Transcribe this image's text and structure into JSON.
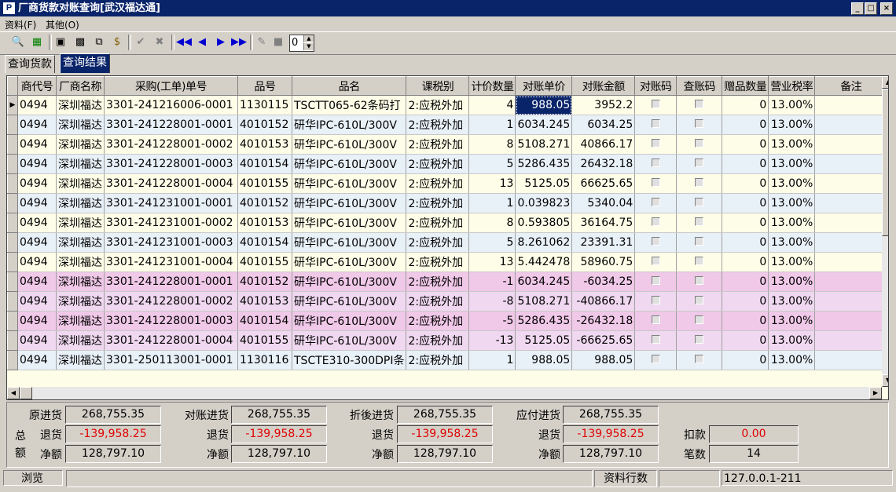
{
  "window": {
    "icon": "P",
    "title": "厂商货款对账查询[武汉福达通]",
    "min": "_",
    "max": "□",
    "close": "×"
  },
  "menu": [
    "资料(F)",
    "其他(O)"
  ],
  "toolbar": {
    "spin_value": "0"
  },
  "tabs": [
    "查询货款",
    "查询结果"
  ],
  "columns": [
    "商代号",
    "厂商名称",
    "采购(工单)单号",
    "品号",
    "品名",
    "课税别",
    "计价数量",
    "对账单价",
    "对账金额",
    "对账码",
    "查账码",
    "赠品数量",
    "营业税率",
    "备注"
  ],
  "rows": [
    [
      "0494",
      "深圳福达",
      "3301-241216006-0001",
      "1130115",
      "TSCTT065-62条码打",
      "2:应税外加",
      "4",
      "988.05",
      "3952.2",
      "",
      "",
      "0",
      "13.00%",
      ""
    ],
    [
      "0494",
      "深圳福达",
      "3301-241228001-0001",
      "4010152",
      "研华IPC-610L/300V",
      "2:应税外加",
      "1",
      "6034.245",
      "6034.25",
      "",
      "",
      "0",
      "13.00%",
      ""
    ],
    [
      "0494",
      "深圳福达",
      "3301-241228001-0002",
      "4010153",
      "研华IPC-610L/300V",
      "2:应税外加",
      "8",
      "5108.271",
      "40866.17",
      "",
      "",
      "0",
      "13.00%",
      ""
    ],
    [
      "0494",
      "深圳福达",
      "3301-241228001-0003",
      "4010154",
      "研华IPC-610L/300V",
      "2:应税外加",
      "5",
      "5286.435",
      "26432.18",
      "",
      "",
      "0",
      "13.00%",
      ""
    ],
    [
      "0494",
      "深圳福达",
      "3301-241228001-0004",
      "4010155",
      "研华IPC-610L/300V",
      "2:应税外加",
      "13",
      "5125.05",
      "66625.65",
      "",
      "",
      "0",
      "13.00%",
      ""
    ],
    [
      "0494",
      "深圳福达",
      "3301-241231001-0001",
      "4010152",
      "研华IPC-610L/300V",
      "2:应税外加",
      "1",
      "0.039823",
      "5340.04",
      "",
      "",
      "0",
      "13.00%",
      ""
    ],
    [
      "0494",
      "深圳福达",
      "3301-241231001-0002",
      "4010153",
      "研华IPC-610L/300V",
      "2:应税外加",
      "8",
      "0.593805",
      "36164.75",
      "",
      "",
      "0",
      "13.00%",
      ""
    ],
    [
      "0494",
      "深圳福达",
      "3301-241231001-0003",
      "4010154",
      "研华IPC-610L/300V",
      "2:应税外加",
      "5",
      "8.261062",
      "23391.31",
      "",
      "",
      "0",
      "13.00%",
      ""
    ],
    [
      "0494",
      "深圳福达",
      "3301-241231001-0004",
      "4010155",
      "研华IPC-610L/300V",
      "2:应税外加",
      "13",
      "5.442478",
      "58960.75",
      "",
      "",
      "0",
      "13.00%",
      ""
    ],
    [
      "0494",
      "深圳福达",
      "3301-241228001-0001",
      "4010152",
      "研华IPC-610L/300V",
      "2:应税外加",
      "-1",
      "6034.245",
      "-6034.25",
      "",
      "",
      "0",
      "13.00%",
      ""
    ],
    [
      "0494",
      "深圳福达",
      "3301-241228001-0002",
      "4010153",
      "研华IPC-610L/300V",
      "2:应税外加",
      "-8",
      "5108.271",
      "-40866.17",
      "",
      "",
      "0",
      "13.00%",
      ""
    ],
    [
      "0494",
      "深圳福达",
      "3301-241228001-0003",
      "4010154",
      "研华IPC-610L/300V",
      "2:应税外加",
      "-5",
      "5286.435",
      "-26432.18",
      "",
      "",
      "0",
      "13.00%",
      ""
    ],
    [
      "0494",
      "深圳福达",
      "3301-241228001-0004",
      "4010155",
      "研华IPC-610L/300V",
      "2:应税外加",
      "-13",
      "5125.05",
      "-66625.65",
      "",
      "",
      "0",
      "13.00%",
      ""
    ],
    [
      "0494",
      "深圳福达",
      "3301-250113001-0001",
      "1130116",
      "TSCTE310-300DPI条",
      "2:应税外加",
      "1",
      "988.05",
      "988.05",
      "",
      "",
      "0",
      "13.00%",
      ""
    ]
  ],
  "totals": {
    "side_label": [
      "总",
      "额"
    ],
    "groups": [
      {
        "labels": [
          "原进货",
          "退货",
          "净额"
        ],
        "values": [
          "268,755.35",
          "-139,958.25",
          "128,797.10"
        ]
      },
      {
        "labels": [
          "对账进货",
          "退货",
          "净额"
        ],
        "values": [
          "268,755.35",
          "-139,958.25",
          "128,797.10"
        ]
      },
      {
        "labels": [
          "折後进货",
          "退货",
          "净额"
        ],
        "values": [
          "268,755.35",
          "-139,958.25",
          "128,797.10"
        ]
      },
      {
        "labels": [
          "应付进货",
          "退货",
          "净额"
        ],
        "values": [
          "268,755.35",
          "-139,958.25",
          "128,797.10"
        ]
      }
    ],
    "deduct_label": "扣款",
    "deduct_value": "0.00",
    "count_label": "笔数",
    "count_value": "14"
  },
  "status": {
    "mode": "浏览",
    "rows_label": "资料行数",
    "rows_value": "",
    "host": "127.0.0.1-211"
  },
  "colors": {
    "title_bg": "#0a246a",
    "row_a": "#fefee8",
    "row_b": "#e8f0f8",
    "row_p1": "#f0d8f0",
    "row_p2": "#f0c8e8",
    "negative": "#e00000"
  }
}
